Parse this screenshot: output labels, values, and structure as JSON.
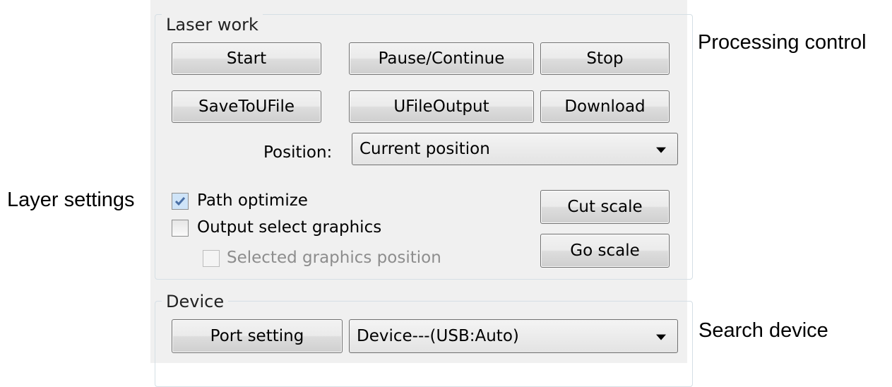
{
  "annotations": {
    "processing_control": "Processing control",
    "layer_settings": "Layer settings",
    "search_device": "Search device"
  },
  "laser_work": {
    "group_label": "Laser work",
    "buttons": {
      "start": "Start",
      "pause_continue": "Pause/Continue",
      "stop": "Stop",
      "save_to_ufile": "SaveToUFile",
      "ufile_output": "UFileOutput",
      "download": "Download",
      "cut_scale": "Cut scale",
      "go_scale": "Go scale"
    },
    "position": {
      "label": "Position:",
      "selected": "Current position"
    },
    "checkboxes": {
      "path_optimize": {
        "label": "Path optimize",
        "checked": true
      },
      "output_select_graphics": {
        "label": "Output select graphics",
        "checked": false
      },
      "selected_graphics_position": {
        "label": "Selected graphics position",
        "checked": false,
        "disabled": true
      }
    }
  },
  "device": {
    "group_label": "Device",
    "port_setting_label": "Port setting",
    "selected": "Device---(USB:Auto)"
  },
  "colors": {
    "panel_bg": "#f0f0f0",
    "group_border": "#d5dfe5",
    "checkbox_check": "#4a6fa5",
    "disabled_text": "#8d8d8d"
  }
}
